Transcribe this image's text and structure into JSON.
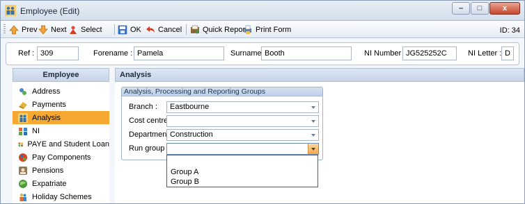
{
  "window": {
    "title": "Employee (Edit)",
    "controls": {
      "minimize": "–",
      "maximize": "□",
      "close": "x"
    }
  },
  "toolbar": {
    "prev": "Prev",
    "next": "Next",
    "select": "Select",
    "ok": "OK",
    "cancel": "Cancel",
    "quick_report": "Quick Report",
    "print_form": "Print Form",
    "record_id": "ID: 34"
  },
  "header": {
    "ref_label": "Ref :",
    "ref_value": "309",
    "forename_label": "Forename :",
    "forename_value": "Pamela",
    "surname_label": "Surname :",
    "surname_value": "Booth",
    "ni_number_label": "NI Number :",
    "ni_number_value": "JG525252C",
    "ni_letter_label": "NI Letter :",
    "ni_letter_value": "D"
  },
  "sidebar": {
    "title": "Employee",
    "items": [
      {
        "label": "Address",
        "icon": "address-icon"
      },
      {
        "label": "Payments",
        "icon": "payments-icon"
      },
      {
        "label": "Analysis",
        "icon": "analysis-icon",
        "active": true
      },
      {
        "label": "NI",
        "icon": "ni-icon"
      },
      {
        "label": "PAYE and Student Loan",
        "icon": "paye-icon"
      },
      {
        "label": "Pay Components",
        "icon": "pay-components-icon"
      },
      {
        "label": "Pensions",
        "icon": "pensions-icon"
      },
      {
        "label": "Expatriate",
        "icon": "expatriate-icon"
      },
      {
        "label": "Holiday Schemes",
        "icon": "holiday-schemes-icon"
      }
    ]
  },
  "main": {
    "title": "Analysis",
    "group_title": "Analysis, Processing and Reporting Groups",
    "fields": {
      "branch": {
        "label": "Branch :",
        "value": "Eastbourne"
      },
      "cost_centre": {
        "label": "Cost centre :",
        "value": ""
      },
      "department": {
        "label": "Department :",
        "value": "Construction"
      },
      "run_group": {
        "label": "Run group :",
        "value": ""
      }
    },
    "run_group_options": [
      "Group A",
      "Group B"
    ]
  },
  "colors": {
    "active_item": "#f7a833",
    "header_band": "#c7d5e7"
  }
}
